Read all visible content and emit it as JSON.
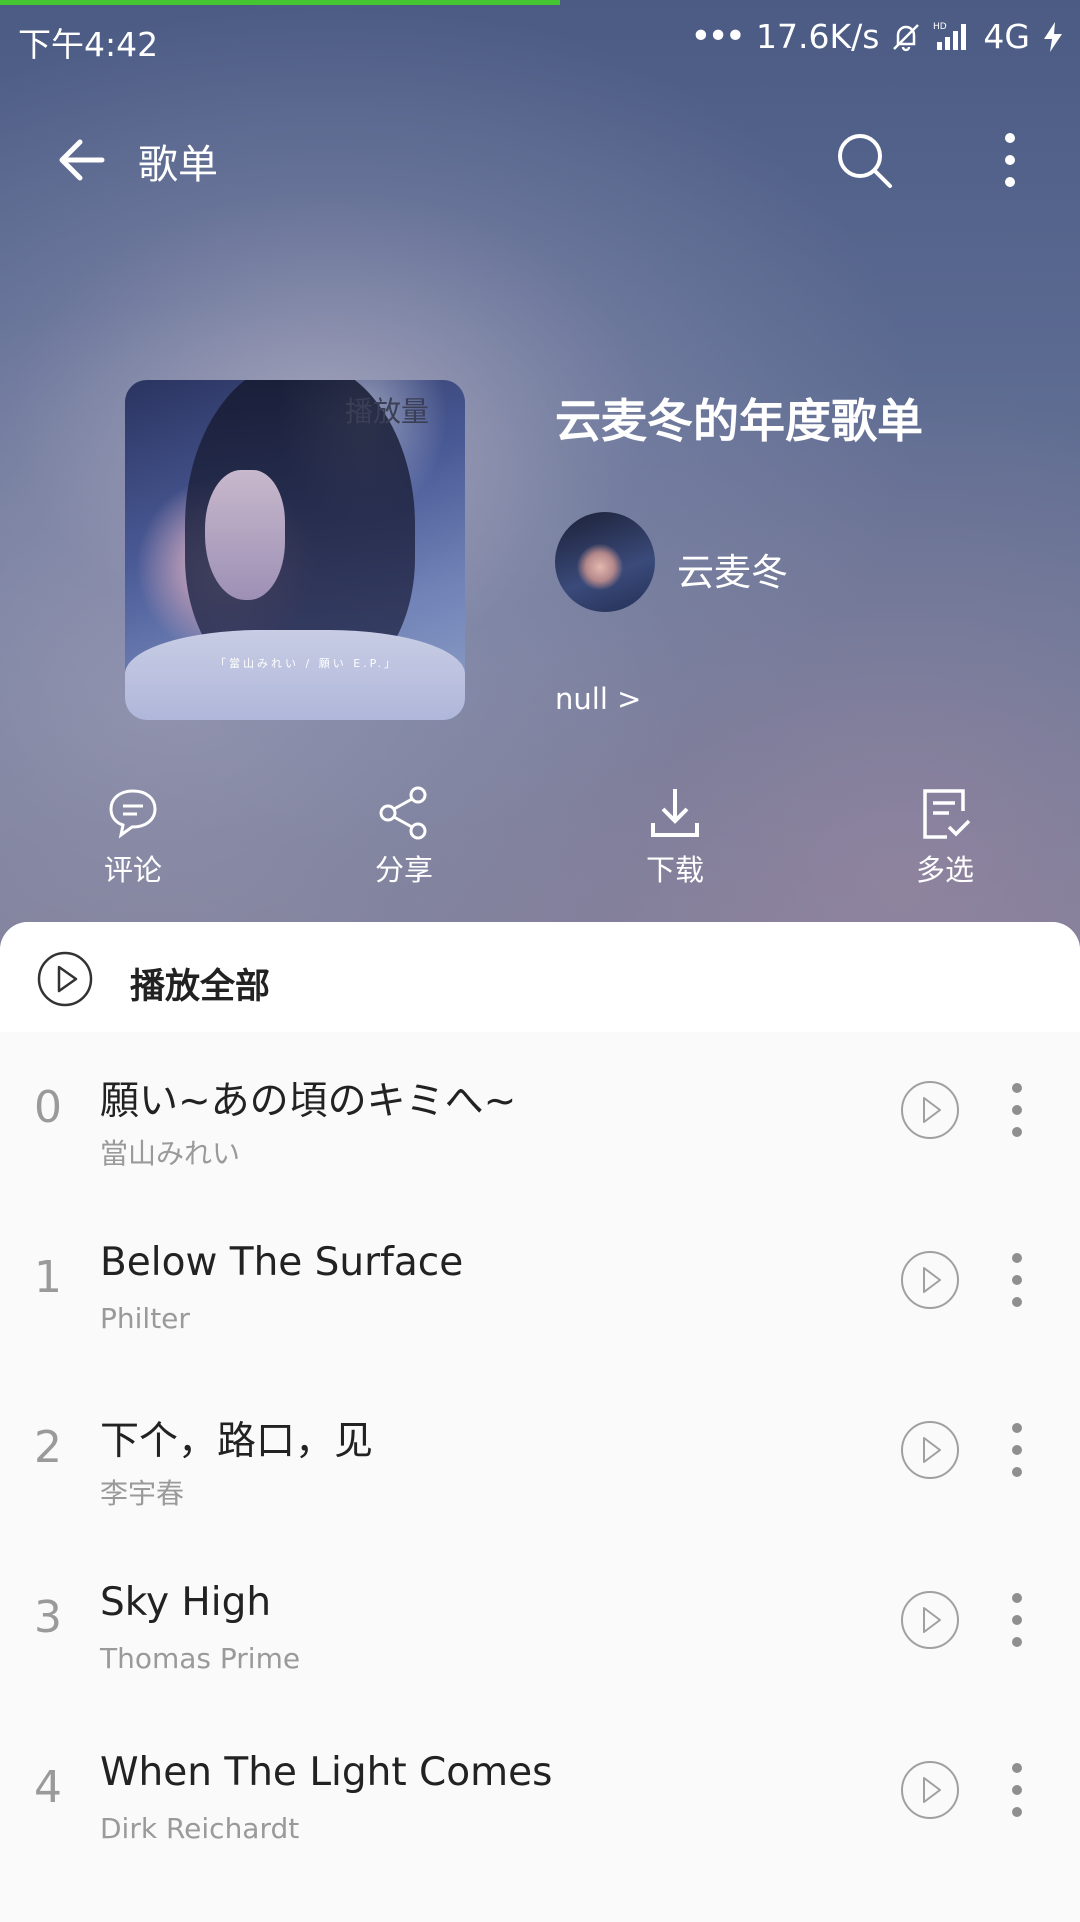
{
  "status_bar": {
    "time": "下午4:42",
    "network_speed": "17.6K/s",
    "network_type": "4G",
    "icons": [
      "more-dots-icon",
      "mute-icon",
      "hd-signal-icon",
      "charging-icon"
    ]
  },
  "app_bar": {
    "title": "歌单",
    "icons": [
      "back-arrow-icon",
      "search-icon",
      "more-vertical-icon"
    ]
  },
  "playlist": {
    "play_count_label": "播放量",
    "cover_caption": "「當山みれい / 願い E.P.」",
    "title": "云麦冬的年度歌单",
    "creator": "云麦冬",
    "description": "null >"
  },
  "actions": [
    {
      "label": "评论",
      "icon": "comment-icon"
    },
    {
      "label": "分享",
      "icon": "share-icon"
    },
    {
      "label": "下载",
      "icon": "download-icon"
    },
    {
      "label": "多选",
      "icon": "multi-select-icon"
    }
  ],
  "play_all": {
    "label": "播放全部"
  },
  "songs": [
    {
      "index": "0",
      "title": "願い~あの頃のキミへ~",
      "artist": "當山みれい"
    },
    {
      "index": "1",
      "title": "Below The Surface",
      "artist": "Philter"
    },
    {
      "index": "2",
      "title": "下个，路口，见",
      "artist": "李宇春"
    },
    {
      "index": "3",
      "title": "Sky High",
      "artist": "Thomas Prime"
    },
    {
      "index": "4",
      "title": "When The Light Comes",
      "artist": "Dirk Reichardt"
    }
  ],
  "colors": {
    "accent_progress": "#44c531",
    "header_bg": "#55648c",
    "text_primary": "#222222",
    "text_secondary": "#9a9a9a"
  }
}
